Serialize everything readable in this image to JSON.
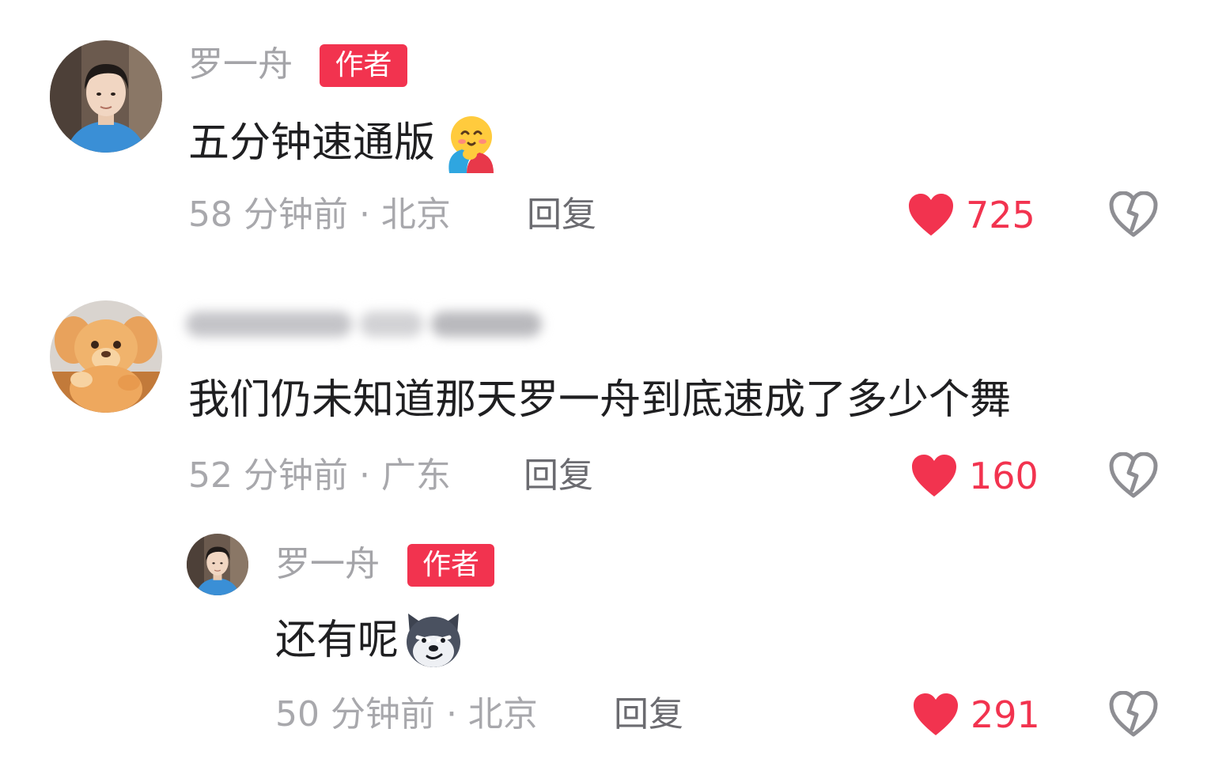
{
  "colors": {
    "accent": "#f2334f",
    "username": "#a4a4a8",
    "text": "#1f1f21",
    "meta": "#a8a8ac",
    "reply": "#6b6b70"
  },
  "comments": [
    {
      "username": "罗一舟",
      "badge": "作者",
      "text": "五分钟速通版",
      "emoji": "hugging-face-emoji",
      "meta": "58 分钟前 · 北京",
      "reply_label": "回复",
      "likes": "725",
      "dislike_icon": "broken-heart-icon"
    },
    {
      "username": "",
      "text": "我们仍未知道那天罗一舟到底速成了多少个舞",
      "meta": "52 分钟前 · 广东",
      "reply_label": "回复",
      "likes": "160",
      "dislike_icon": "broken-heart-icon"
    },
    {
      "username": "罗一舟",
      "badge": "作者",
      "text": "还有呢",
      "emoji": "smirking-dog-emoji",
      "meta": "50 分钟前 · 北京",
      "reply_label": "回复",
      "likes": "291",
      "dislike_icon": "broken-heart-icon"
    }
  ]
}
